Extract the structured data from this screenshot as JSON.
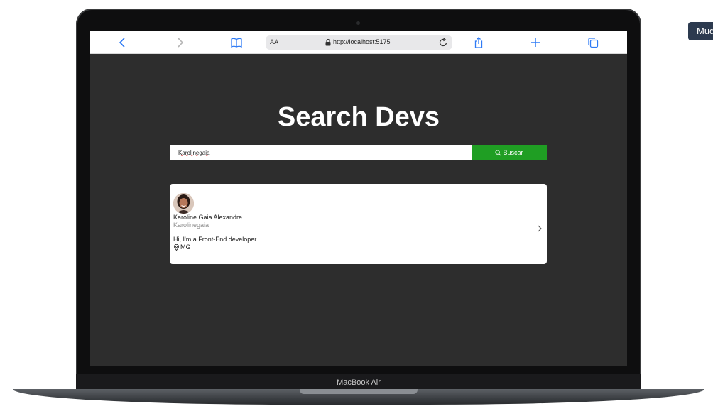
{
  "corner_button": {
    "label": "Mudar"
  },
  "device": {
    "brand": "MacBook Air"
  },
  "browser": {
    "text_size_label": "AA",
    "url": "http://localhost:5175"
  },
  "page": {
    "title": "Search Devs",
    "search": {
      "value": "Karolinegaia",
      "button_label": "Buscar"
    },
    "result": {
      "name": "Karoline Gaia Alexandre",
      "login": "Karolinegaia",
      "bio": "Hi, I'm a Front-End developer",
      "location": "MG"
    }
  },
  "colors": {
    "page_bg": "#2d2d2d",
    "search_button": "#1f9e23",
    "safari_blue": "#2f7bf5"
  }
}
